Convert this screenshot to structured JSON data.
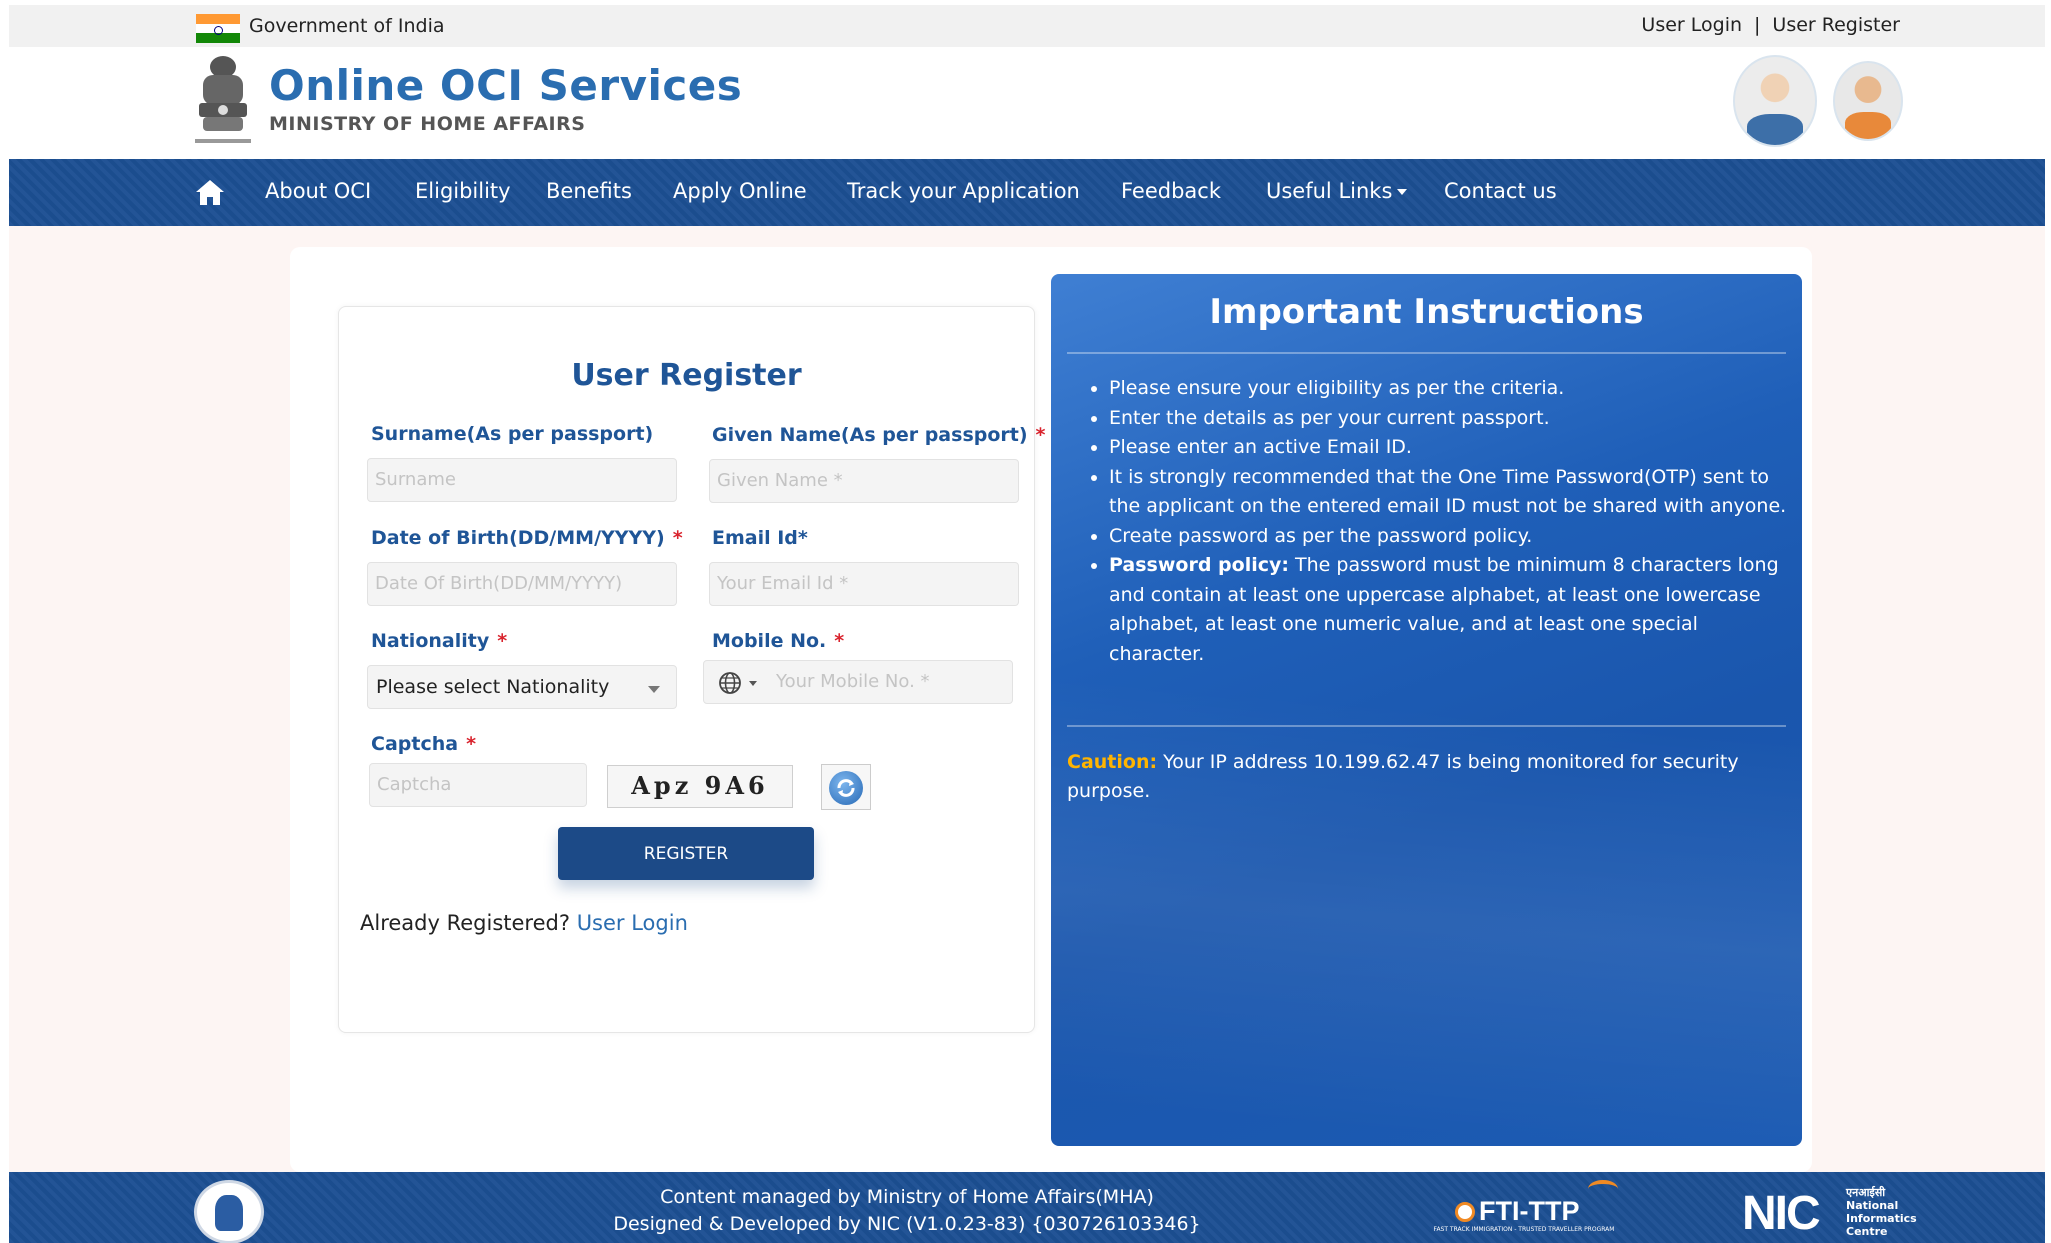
{
  "topbar": {
    "gov_text": "Government of India",
    "user_login": "User Login",
    "separator": "|",
    "user_register": "User Register"
  },
  "header": {
    "title": "Online OCI Services",
    "subtitle": "MINISTRY OF HOME AFFAIRS"
  },
  "nav": {
    "items": [
      {
        "label": "About OCI"
      },
      {
        "label": "Eligibility"
      },
      {
        "label": "Benefits"
      },
      {
        "label": "Apply Online"
      },
      {
        "label": "Track your Application"
      },
      {
        "label": "Feedback"
      },
      {
        "label": "Useful Links"
      },
      {
        "label": "Contact us"
      }
    ]
  },
  "form": {
    "title": "User Register",
    "surname": {
      "label": "Surname(As per passport)",
      "placeholder": "Surname"
    },
    "given_name": {
      "label": "Given Name(As per passport)",
      "placeholder": "Given Name *"
    },
    "dob": {
      "label": "Date of Birth(DD/MM/YYYY)",
      "placeholder": "Date Of Birth(DD/MM/YYYY)"
    },
    "email": {
      "label": "Email Id*",
      "placeholder": "Your Email Id *"
    },
    "nationality": {
      "label": "Nationality",
      "selected": "Please select Nationality"
    },
    "mobile": {
      "label": "Mobile No.",
      "placeholder": "Your Mobile No. *"
    },
    "captcha": {
      "label": "Captcha",
      "placeholder": "Captcha",
      "image_text": "Apz 9A6"
    },
    "required_mark": "*",
    "register_label": "REGISTER",
    "already_text": "Already Registered?",
    "login_link": "User Login"
  },
  "instructions": {
    "title": "Important Instructions",
    "items": [
      "Please ensure your eligibility as per the criteria.",
      "Enter the details as per your current passport.",
      "Please enter an active Email ID.",
      "It is strongly recommended that the One Time Password(OTP) sent to the applicant on the entered email ID must not be shared with anyone.",
      "Create password as per the password policy."
    ],
    "policy_title": "Password policy:",
    "policy_text": " The password must be minimum 8 characters long and contain at least one uppercase alphabet, at least one lowercase alphabet, at least one numeric value, and at least one special character.",
    "caution_label": "Caution:",
    "caution_text": " Your IP address 10.199.62.47 is being monitored for security purpose."
  },
  "footer": {
    "line1": "Content managed by Ministry of Home Affairs(MHA)",
    "line2": "Designed & Developed by NIC (V1.0.23-83) {030726103346}",
    "fti_logo": "FTI-TTP",
    "fti_tagline": "FAST TRACK IMMIGRATION - TRUSTED TRAVELLER PROGRAM",
    "nic_logo": "NIC",
    "nic_hindi": "एनआईसी",
    "nic_name": "National Informatics Centre"
  },
  "colors": {
    "nav_bg": "#1c4f93",
    "accent_blue": "#1f5597",
    "required_red": "#d9232d",
    "caution_orange": "#ffb400"
  },
  "icons": {
    "home": "home-icon",
    "globe": "globe-icon",
    "refresh": "refresh-icon",
    "dropdown": "chevron-down-icon"
  }
}
